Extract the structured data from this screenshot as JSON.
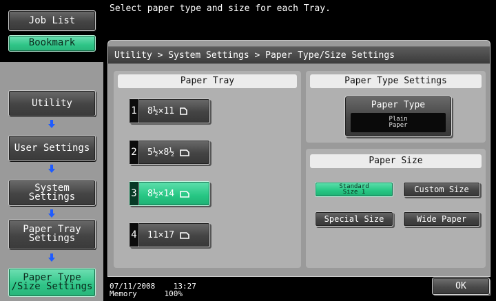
{
  "message": "Select paper type and size for each Tray.",
  "left_nav": {
    "job_list": "Job List",
    "bookmark": "Bookmark",
    "items": [
      {
        "label": "Utility"
      },
      {
        "label": "User Settings"
      },
      {
        "label": "System Settings"
      },
      {
        "label": "Paper Tray\nSettings"
      },
      {
        "label": "Paper Type\n/Size Settings"
      }
    ]
  },
  "breadcrumb": "Utility > System Settings > Paper Type/Size Settings",
  "paper_tray": {
    "heading": "Paper Tray",
    "trays": [
      {
        "num": "1",
        "size": "8½×11"
      },
      {
        "num": "2",
        "size": "5½×8½"
      },
      {
        "num": "3",
        "size": "8½×14"
      },
      {
        "num": "4",
        "size": "11×17"
      }
    ],
    "selected_index": 2
  },
  "paper_type_settings": {
    "heading": "Paper Type Settings",
    "button_label": "Paper Type",
    "value_line1": "Plain",
    "value_line2": "Paper"
  },
  "paper_size": {
    "heading": "Paper Size",
    "standard_line1": "Standard",
    "standard_line2": "Size 1",
    "custom": "Custom Size",
    "special": "Special Size",
    "wide": "Wide Paper"
  },
  "status": {
    "date": "07/11/2008",
    "time": "13:27",
    "memory_label": "Memory",
    "memory_value": "100%"
  },
  "ok": "OK",
  "colors": {
    "selected": "#2fc487",
    "panel": "#9a9a9a",
    "arrow": "#1e5bff"
  }
}
